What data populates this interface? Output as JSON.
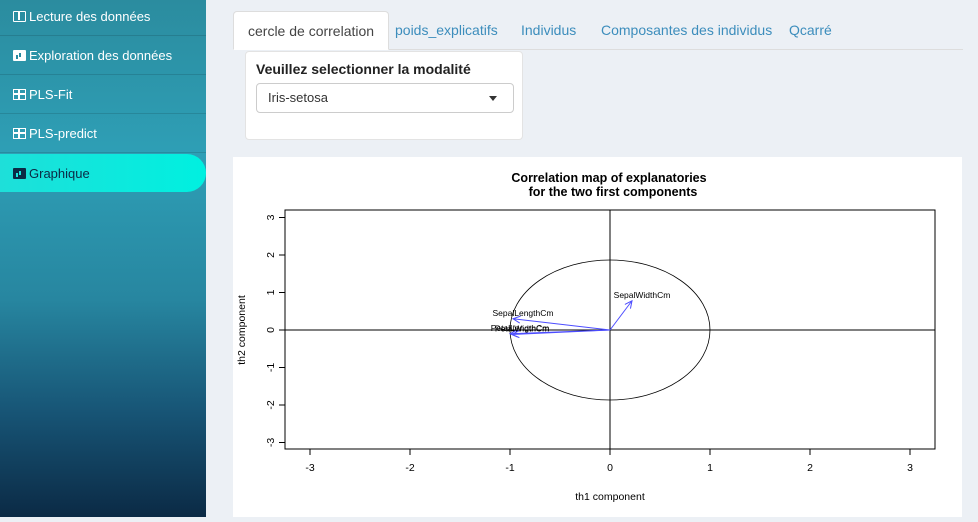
{
  "sidebar": {
    "items": [
      {
        "label": "Lecture des données",
        "icon": "book-icon"
      },
      {
        "label": "Exploration des données",
        "icon": "bar-chart-icon"
      },
      {
        "label": "PLS-Fit",
        "icon": "table-icon"
      },
      {
        "label": "PLS-predict",
        "icon": "table-icon"
      },
      {
        "label": "Graphique",
        "icon": "bar-chart-icon",
        "active": true
      }
    ],
    "active_color": "#00f0e0"
  },
  "tabs": [
    {
      "label": "cercle de correlation",
      "active": true
    },
    {
      "label": "poids_explicatifs"
    },
    {
      "label": "Individus"
    },
    {
      "label": "Composantes des individus"
    },
    {
      "label": "Qcarré"
    }
  ],
  "panel": {
    "label": "Veuillez selectionner la modalité",
    "select_value": "Iris-setosa"
  },
  "chart_data": {
    "type": "scatter",
    "title": "Correlation map of explanatories",
    "subtitle": "for the two first components",
    "xlabel": "th1 component",
    "ylabel": "th2 component",
    "xlim": [
      -3,
      3
    ],
    "ylim": [
      -3,
      3
    ],
    "xticks": [
      -3,
      -2,
      -1,
      0,
      1,
      2,
      3
    ],
    "yticks": [
      -3,
      -2,
      -1,
      0,
      1,
      2,
      3
    ],
    "circle_radius": 1,
    "arrow_color": "#4d4dff",
    "vectors": [
      {
        "name": "SepalWidthCm",
        "x": 0.22,
        "y": 0.78
      },
      {
        "name": "SepalLengthCm",
        "x": -0.97,
        "y": 0.3
      },
      {
        "name": "PetalLengthCm",
        "x": -1.0,
        "y": -0.1
      },
      {
        "name": "PetalWidthCm",
        "x": -0.98,
        "y": -0.12
      }
    ]
  }
}
